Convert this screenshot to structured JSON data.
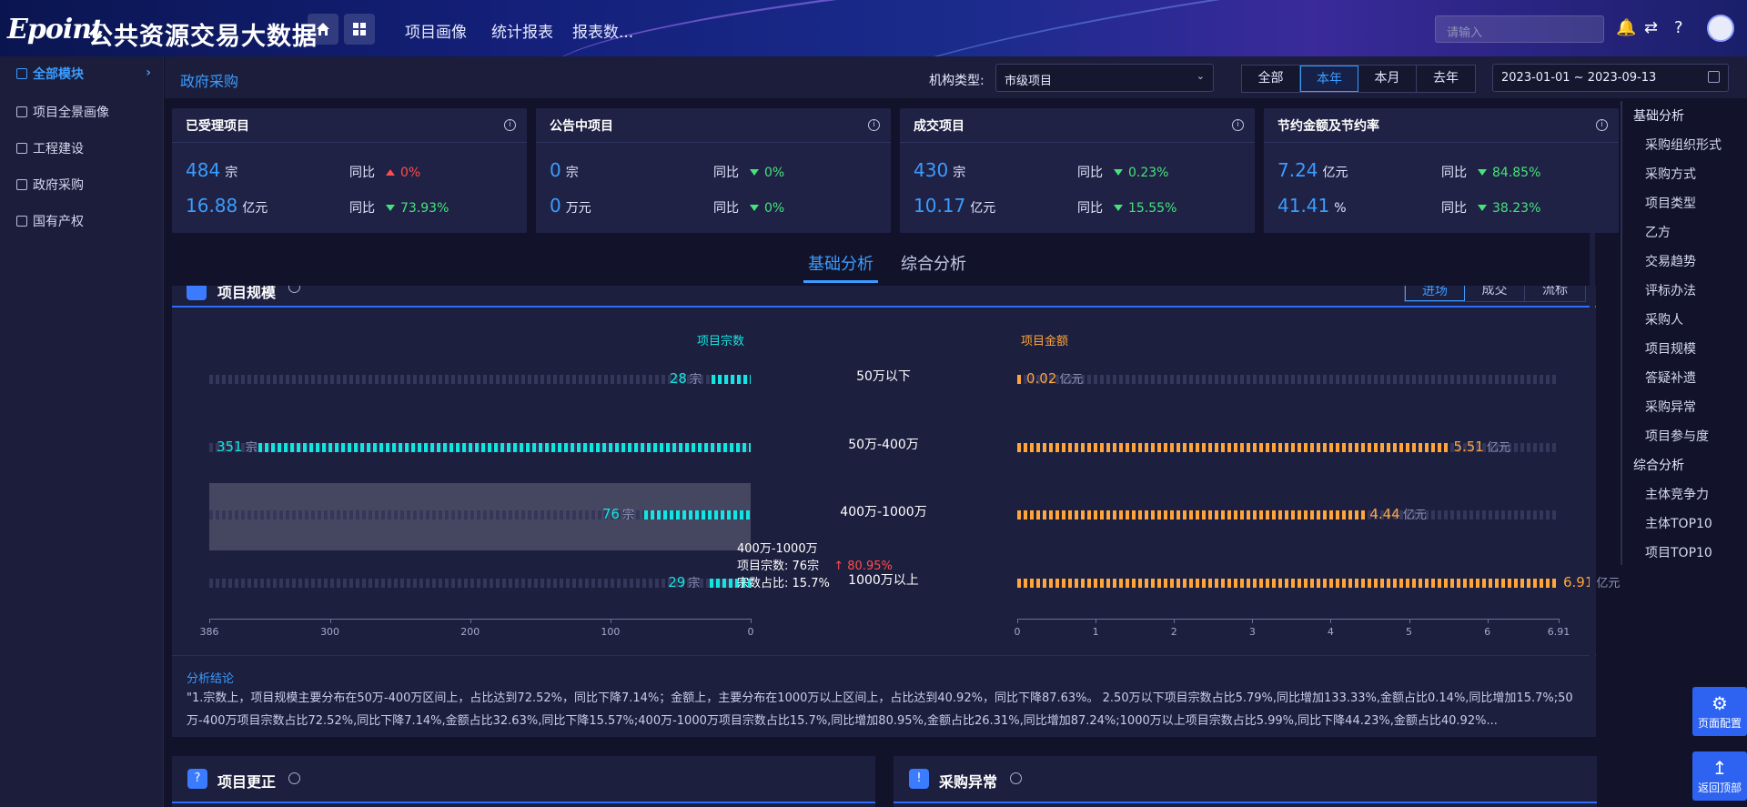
{
  "header": {
    "logo": "Epoint",
    "title": "公共资源交易大数据",
    "nav": [
      "项目画像",
      "统计报表",
      "报表数..."
    ],
    "search_placeholder": "请输入"
  },
  "sidebar": {
    "items": [
      {
        "label": "全部模块",
        "active": true
      },
      {
        "label": "项目全景画像"
      },
      {
        "label": "工程建设"
      },
      {
        "label": "政府采购"
      },
      {
        "label": "国有产权"
      }
    ]
  },
  "breadcrumb": "政府采购",
  "filter": {
    "org_label": "机构类型:",
    "org_value": "市级项目",
    "periods": [
      "全部",
      "本年",
      "本月",
      "去年"
    ],
    "active_period": "本年",
    "date_range": "2023-01-01 ~ 2023-09-13"
  },
  "cards": [
    {
      "title": "已受理项目",
      "r1_value": "484",
      "r1_unit": "宗",
      "r1_yoy_label": "同比",
      "r1_yoy": "0%",
      "r1_dir": "up",
      "r2_value": "16.88",
      "r2_unit": "亿元",
      "r2_yoy_label": "同比",
      "r2_yoy": "73.93%",
      "r2_dir": "down"
    },
    {
      "title": "公告中项目",
      "r1_value": "0",
      "r1_unit": "宗",
      "r1_yoy_label": "同比",
      "r1_yoy": "0%",
      "r1_dir": "down",
      "r2_value": "0",
      "r2_unit": "万元",
      "r2_yoy_label": "同比",
      "r2_yoy": "0%",
      "r2_dir": "down"
    },
    {
      "title": "成交项目",
      "r1_value": "430",
      "r1_unit": "宗",
      "r1_yoy_label": "同比",
      "r1_yoy": "0.23%",
      "r1_dir": "down",
      "r2_value": "10.17",
      "r2_unit": "亿元",
      "r2_yoy_label": "同比",
      "r2_yoy": "15.55%",
      "r2_dir": "down"
    },
    {
      "title": "节约金额及节约率",
      "r1_value": "7.24",
      "r1_unit": "亿元",
      "r1_yoy_label": "同比",
      "r1_yoy": "84.85%",
      "r1_dir": "down",
      "r2_value": "41.41",
      "r2_unit": "%",
      "r2_yoy_label": "同比",
      "r2_yoy": "38.23%",
      "r2_dir": "down"
    }
  ],
  "tabs": [
    "基础分析",
    "综合分析"
  ],
  "panel": {
    "title": "项目规模",
    "modes": [
      "进场",
      "成交",
      "流标"
    ],
    "active_mode": "进场"
  },
  "chart_data": {
    "type": "bar",
    "categories": [
      "50万以下",
      "50万-400万",
      "400万-1000万",
      "1000万以上"
    ],
    "series": [
      {
        "name": "项目宗数",
        "unit": "宗",
        "values": [
          28,
          351,
          76,
          29
        ],
        "axis_max": 386,
        "ticks": [
          "386",
          "300",
          "200",
          "100",
          "0"
        ],
        "color": "#13e6e0"
      },
      {
        "name": "项目金额",
        "unit": "亿元",
        "values": [
          0.02,
          5.51,
          4.44,
          6.91
        ],
        "axis_max": 6.91,
        "ticks": [
          "0",
          "1",
          "2",
          "3",
          "4",
          "5",
          "6",
          "6.91"
        ],
        "color": "#ffa53b"
      }
    ],
    "labels_count": [
      "28",
      "351",
      "76",
      "29"
    ],
    "labels_amount": [
      "0.02",
      "5.51",
      "4.44",
      "6.91"
    ]
  },
  "tooltip": {
    "title": "400万-1000万",
    "line1_label": "项目宗数:",
    "line1_value": "76宗",
    "line1_change": "80.95%",
    "line2_label": "宗数占比:",
    "line2_value": "15.7%"
  },
  "conclusion": {
    "title": "分析结论",
    "text": "\"1.宗数上，项目规模主要分布在50万-400万区间上，占比达到72.52%，同比下降7.14%；金额上，主要分布在1000万以上区间上，占比达到40.92%，同比下降87.63%。 2.50万以下项目宗数占比5.79%,同比增加133.33%,金额占比0.14%,同比增加15.7%;50万-400万项目宗数占比72.52%,同比下降7.14%,金额占比32.63%,同比下降15.57%;400万-1000万项目宗数占比15.7%,同比增加80.95%,金额占比26.31%,同比增加87.24%;1000万以上项目宗数占比5.99%,同比下降44.23%,金额占比40.92%..."
  },
  "bottom_panels": [
    {
      "icon": "?",
      "title": "项目更正"
    },
    {
      "icon": "!",
      "title": "采购异常"
    }
  ],
  "rightnav": {
    "groups": [
      {
        "label": "基础分析",
        "items": [
          "采购组织形式",
          "采购方式",
          "项目类型",
          "乙方",
          "交易趋势",
          "评标办法",
          "采购人",
          "项目规模",
          "答疑补遗",
          "采购异常",
          "项目参与度"
        ]
      },
      {
        "label": "综合分析",
        "items": [
          "主体竞争力",
          "主体TOP10",
          "项目TOP10"
        ]
      }
    ]
  },
  "float_buttons": [
    "页面配置",
    "返回顶部"
  ]
}
